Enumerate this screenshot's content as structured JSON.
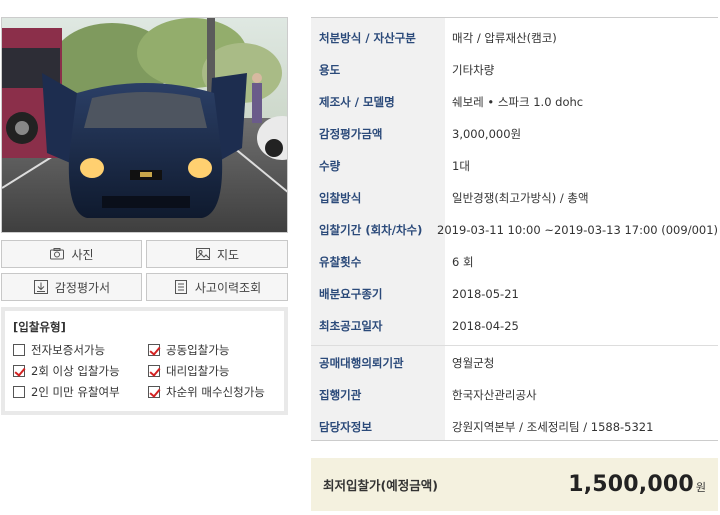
{
  "photo": {
    "alt_subject": "car-photo"
  },
  "buttons": {
    "photo_label": "사진",
    "map_label": "지도",
    "appraisal_label": "감정평가서",
    "accident_label": "사고이력조회",
    "photo_icon": "camera-icon",
    "map_icon": "map-icon",
    "appraisal_icon": "download-icon",
    "accident_icon": "document-list-icon"
  },
  "bid_type": {
    "title": "[입찰유형]",
    "items": [
      {
        "label": "전자보증서가능",
        "checked": false
      },
      {
        "label": "공동입찰가능",
        "checked": true
      },
      {
        "label": "2회 이상 입찰가능",
        "checked": true
      },
      {
        "label": "대리입찰가능",
        "checked": true
      },
      {
        "label": "2인 미만 유찰여부",
        "checked": false
      },
      {
        "label": "차순위 매수신청가능",
        "checked": true
      }
    ]
  },
  "info": {
    "rows": [
      {
        "label": "처분방식 / 자산구분",
        "value": "매각 / 압류재산(캠코)"
      },
      {
        "label": "용도",
        "value": "기타차량"
      },
      {
        "label": "제조사 / 모델명",
        "value": "쉐보레 • 스파크 1.0 dohc"
      },
      {
        "label": "감정평가금액",
        "value": "3,000,000원"
      },
      {
        "label": "수량",
        "value": "1대"
      },
      {
        "label": "입찰방식",
        "value": "일반경쟁(최고가방식) / 총액"
      },
      {
        "label": "입찰기간 (회차/차수)",
        "value": "2019-03-11 10:00 ~2019-03-13 17:00 (009/001)"
      },
      {
        "label": "유찰횟수",
        "value": "6 회"
      },
      {
        "label": "배분요구종기",
        "value": "2018-05-21"
      },
      {
        "label": "최초공고일자",
        "value": "2018-04-25"
      },
      {
        "label": "공매대행의뢰기관",
        "value": "영월군청"
      },
      {
        "label": "집행기관",
        "value": "한국자산관리공사"
      },
      {
        "label": "담당자정보",
        "value": "강원지역본부 / 조세정리팀 / 1588-5321"
      }
    ]
  },
  "min_bid": {
    "label": "최저입찰가(예정금액)",
    "amount": "1,500,000",
    "unit": "원"
  },
  "colors": {
    "label_text": "#2b4a7a",
    "check_mark": "#d32222",
    "min_bid_bg": "#f4f1df"
  }
}
